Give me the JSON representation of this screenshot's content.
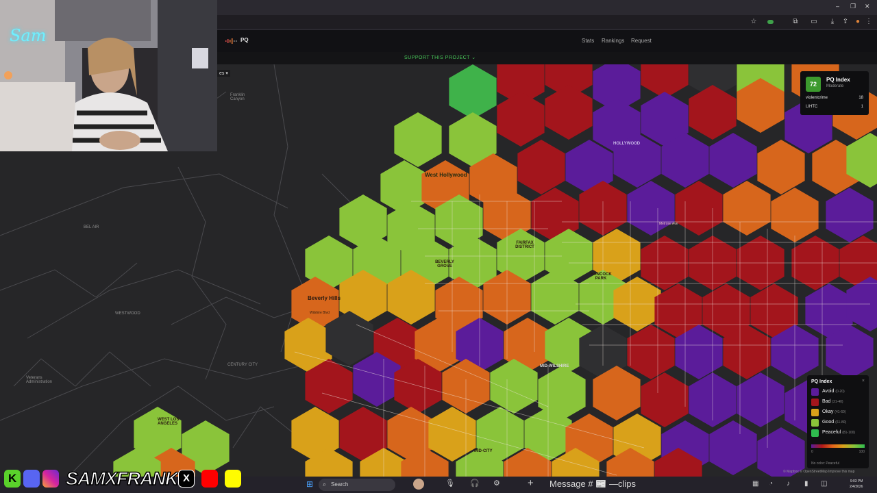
{
  "browser": {
    "window_controls": [
      "–",
      "❐",
      "✕"
    ]
  },
  "site": {
    "logo": "PQ",
    "nav": [
      "Stats",
      "Rankings",
      "Request"
    ],
    "support_link": "SUPPORT THIS PROJECT ⌄",
    "dropdown_fragment": "es ▾"
  },
  "map": {
    "labels": {
      "west_hollywood": "West Hollywood",
      "fairfax": "FAIRFAX DISTRICT",
      "beverly_hills": "Beverly Hills",
      "mid_wilshire": "MID-WILSHIRE",
      "mid_city": "MID-CITY",
      "west_la": "WEST LOS ANGELES",
      "westwood": "WESTWOOD",
      "bel_air": "BEL AIR",
      "franklin_canyon": "Franklin Canyon",
      "veterans": "Veterans Administration",
      "century_city": "CENTURY CITY",
      "hollywood": "HOLLYWOOD",
      "hancock_park": "HANCOCK PARK",
      "beverly_grove": "BEVERLY GROVE",
      "melrose_ave": "Melrose Ave",
      "wilshire_blvd": "Wilshire Blvd"
    }
  },
  "pq_card": {
    "score": "72",
    "title": "PQ Index",
    "subtitle": "Moderate",
    "rows": [
      {
        "label": "violentcrime",
        "value": "18"
      },
      {
        "label": "LIHTC",
        "value": "1"
      }
    ]
  },
  "legend": {
    "title": "PQ Index",
    "close": "×",
    "items": [
      {
        "label": "Avoid",
        "range": "(0-20)",
        "color": "#5b1c9a"
      },
      {
        "label": "Bad",
        "range": "(21-40)",
        "color": "#a3151c"
      },
      {
        "label": "Okay",
        "range": "(41-60)",
        "color": "#d9a11a"
      },
      {
        "label": "Good",
        "range": "(61-80)",
        "color": "#8ac43a"
      },
      {
        "label": "Peaceful",
        "range": "(81-100)",
        "color": "#2fbb4e"
      }
    ],
    "min": "0",
    "max": "100",
    "no_color": "No color: Peaceful"
  },
  "attribution": "© Mapbox © OpenStreetMap Improve this map",
  "taskbar": {
    "search": "Search",
    "message": "Message # 📰 —clips",
    "time": "9:03 PM",
    "date": "2/4/2026"
  },
  "overlay": {
    "handle": "SAMXFRANK",
    "webcam_sign": "Sam"
  },
  "colors": {
    "avoid": "#5b1c9a",
    "bad": "#a3151c",
    "orange": "#d7661c",
    "okay": "#d9a11a",
    "good": "#8ac43a",
    "peaceful": "#3fb24a",
    "unscored": "#2f2f31"
  }
}
